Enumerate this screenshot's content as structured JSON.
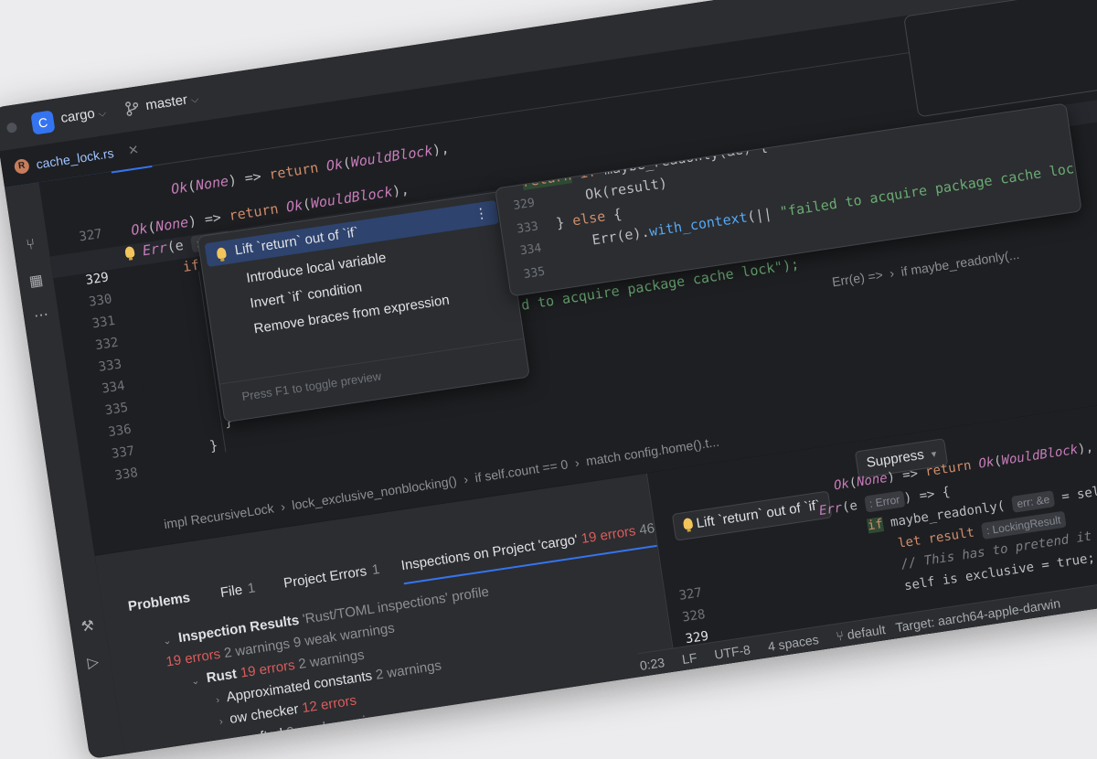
{
  "titlebar": {
    "project_badge": "C",
    "project_name": "cargo",
    "branch": "master"
  },
  "tab": {
    "file": "cache_lock.rs"
  },
  "gutter": {
    "lines": [
      "327",
      "328",
      "329",
      "330",
      "331",
      "332",
      "333",
      "334",
      "335",
      "336",
      "337",
      "338"
    ],
    "current": "329"
  },
  "editor": {
    "line0": "Ok(None) => return Ok(WouldBlock),",
    "hint_err": ": Error",
    "hint_e": "err: &e"
  },
  "popup": {
    "items": [
      "Lift `return` out of `if`",
      "Introduce local variable",
      "Invert `if` condition",
      "Remove braces from expression"
    ],
    "more": "⋮",
    "footer": "Press F1 to toggle preview"
  },
  "preview": {
    "lines": [
      "329",
      "333",
      "334",
      "335"
    ],
    "l1_text": "return if maybe_readonly(&e) {",
    "l2_text": "Ok(result)",
    "l3_text": "} else {",
    "l4_text": "Err(e).with_context(|| \"failed to acquire package cache lock\")",
    "l5_text": "Err(e).with_context(|| \"failed to acquire package cache lock\");"
  },
  "editor_tail": {
    "fragment": "d to acquire package cache lock\");",
    "crumbs": "Err(e) =>  ›  if maybe_readonly(..."
  },
  "breadcrumbs": {
    "items": [
      "impl RecursiveLock",
      "lock_exclusive_nonblocking()",
      "if self.count == 0",
      "match config.home().t..."
    ]
  },
  "problems": {
    "title": "Problems",
    "tabs": [
      {
        "label": "File",
        "count": "1"
      },
      {
        "label": "Project Errors",
        "count": "1"
      },
      {
        "label": "Inspections on Project 'cargo'",
        "count": ""
      }
    ],
    "tab_errors": "19 errors",
    "tab_more": "46",
    "results_label": "Inspection Results",
    "results_profile": "'Rust/TOML inspections' profile",
    "results_errors": "19 errors",
    "results_warnings": "2 warnings 9 weak warnings",
    "rust_label": "Rust",
    "rust_errors": "19 errors",
    "rust_warnings": "2 warnings",
    "approx_label": "Approximated constants",
    "approx_count": "2 warnings",
    "borrow_label": "ow checker",
    "borrow_errors": "12 errors",
    "weak_label": "fted",
    "weak_count": "9 weak warnings"
  },
  "right_pane": {
    "fix_label": "Lift `return` out of `if`",
    "suppress": "Suppress",
    "lines": [
      "327",
      "328",
      "329",
      "330",
      "331"
    ],
    "hint_locking": ": LockingResult",
    "code_let": "let result",
    "code_comment": "// This has to pretend it is exclusiv",
    "code_self": "self.lock_s",
    "code_self2": "self is exclusive = true;"
  },
  "status": {
    "time": "0:23",
    "lf": "LF",
    "encoding": "UTF-8",
    "indent": "4 spaces",
    "branch": "default",
    "target": "Target: aarch64-apple-darwin"
  }
}
